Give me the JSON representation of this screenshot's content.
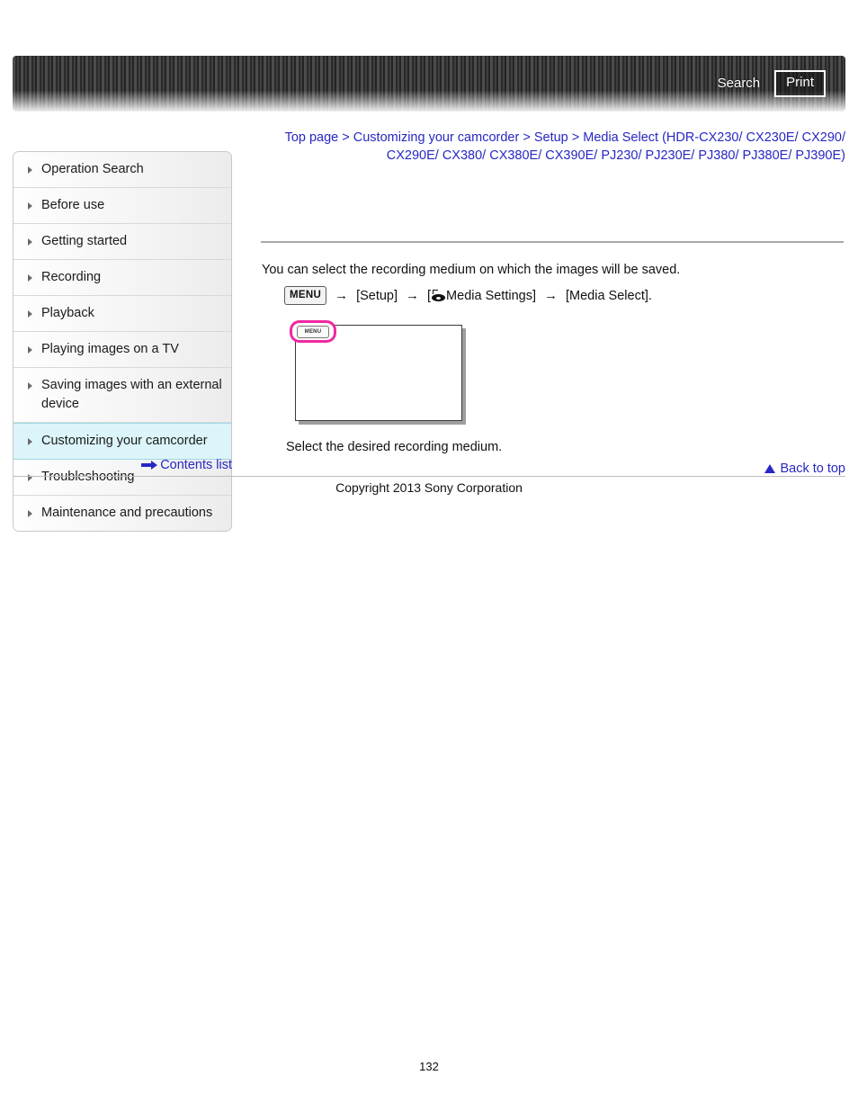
{
  "header": {
    "search_label": "Search",
    "print_label": "Print"
  },
  "breadcrumb": {
    "separator": ">",
    "items": [
      "Top page",
      "Customizing your camcorder",
      "Setup",
      "Media Select (HDR-CX230/ CX230E/ CX290/ CX290E/ CX380/ CX380E/ CX390E/ PJ230/ PJ230E/ PJ380/ PJ380E/ PJ390E)"
    ],
    "line1": "Top page > Customizing your camcorder > Setup > Media Select (HDR-CX230/ CX230E/ CX290/",
    "line2": "CX290E/ CX380/ CX380E/ CX390E/ PJ230/ PJ230E/ PJ380/ PJ380E/ PJ390E)"
  },
  "sidebar": {
    "items": [
      {
        "label": "Operation Search",
        "active": false
      },
      {
        "label": "Before use",
        "active": false
      },
      {
        "label": "Getting started",
        "active": false
      },
      {
        "label": "Recording",
        "active": false
      },
      {
        "label": "Playback",
        "active": false
      },
      {
        "label": "Playing images on a TV",
        "active": false
      },
      {
        "label": "Saving images with an external device",
        "active": false
      },
      {
        "label": "Customizing your camcorder",
        "active": true
      },
      {
        "label": "Troubleshooting",
        "active": false
      },
      {
        "label": "Maintenance and precautions",
        "active": false
      }
    ],
    "contents_list_label": "Contents list"
  },
  "main": {
    "intro_text": "You can select the recording medium on which the images will be saved.",
    "menu_path": {
      "menu_chip": "MENU",
      "arrow": "→",
      "step2": "[Setup]",
      "step3_prefix": "[",
      "step3_label": "Media Settings]",
      "step4": "[Media Select]."
    },
    "figure": {
      "menu_chip": "MENU"
    },
    "figure_caption": "Select the desired recording medium."
  },
  "footer": {
    "back_to_top_label": "Back to top",
    "copyright": "Copyright 2013 Sony Corporation",
    "page_number": "132"
  }
}
